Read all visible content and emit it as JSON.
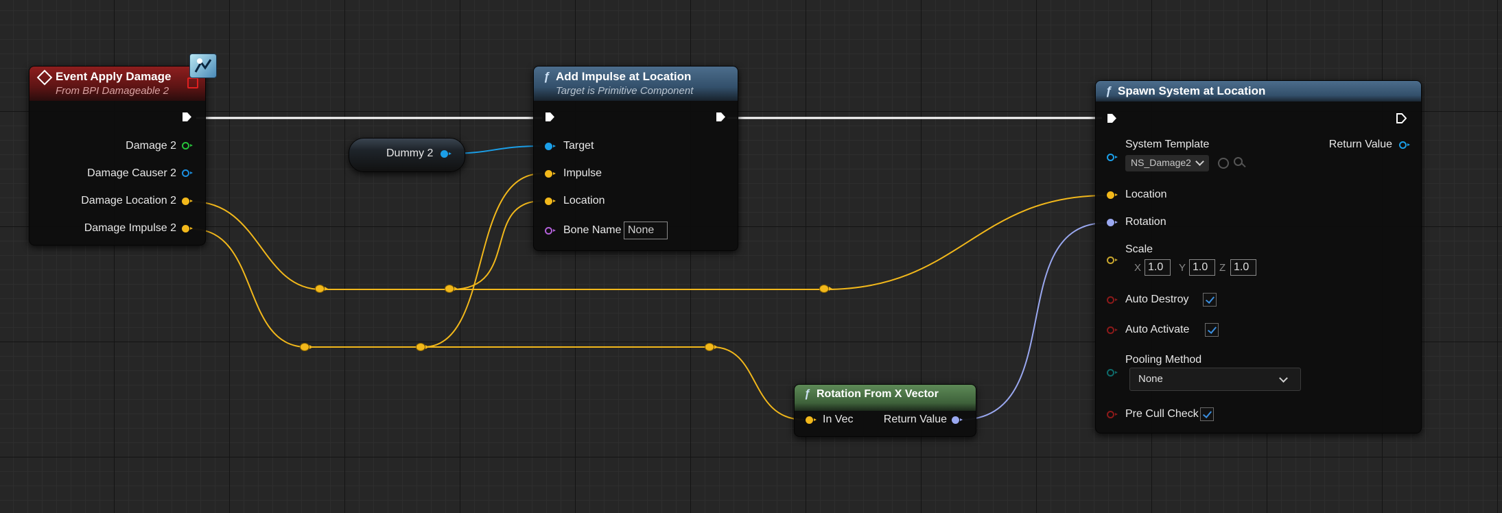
{
  "event_node": {
    "title": "Event Apply Damage",
    "subtitle": "From BPI Damageable 2",
    "pins": [
      {
        "label": "Damage 2",
        "color": "#27c23a"
      },
      {
        "label": "Damage Causer 2",
        "color": "#1b8fe0"
      },
      {
        "label": "Damage Location 2",
        "color": "#f2b81b"
      },
      {
        "label": "Damage Impulse 2",
        "color": "#f2b81b"
      }
    ],
    "icon": "interface-message-icon"
  },
  "dummy_node": {
    "label": "Dummy 2",
    "color": "#1b9fe8"
  },
  "add_impulse_node": {
    "title": "Add Impulse at Location",
    "subtitle": "Target is Primitive Component",
    "pins": {
      "target": "Target",
      "impulse": "Impulse",
      "location": "Location",
      "bone_name": "Bone Name",
      "bone_name_value": "None"
    }
  },
  "rotation_node": {
    "title": "Rotation From X Vector",
    "in_pin": "In Vec",
    "out_pin": "Return Value"
  },
  "spawn_node": {
    "title": "Spawn System at Location",
    "system_template_label": "System Template",
    "system_template_value": "NS_Damage2",
    "return_value": "Return Value",
    "location": "Location",
    "rotation": "Rotation",
    "scale": "Scale",
    "scale_x_label": "X",
    "scale_y_label": "Y",
    "scale_z_label": "Z",
    "scale_x": "1.0",
    "scale_y": "1.0",
    "scale_z": "1.0",
    "auto_destroy": "Auto Destroy",
    "auto_destroy_checked": true,
    "auto_activate": "Auto Activate",
    "auto_activate_checked": true,
    "pooling_method": "Pooling Method",
    "pooling_method_value": "None",
    "pre_cull_check": "Pre Cull Check",
    "pre_cull_check_checked": true
  },
  "colors": {
    "vector_wire": "#f2b81b",
    "rotator_wire": "#9aa8f0",
    "object_pin": "#1b9fe8",
    "exec_wire": "#ffffff",
    "name_pin": "#b160d8",
    "bool_pin": "#8c1a1a",
    "enum_pin": "#0e6b6b"
  }
}
